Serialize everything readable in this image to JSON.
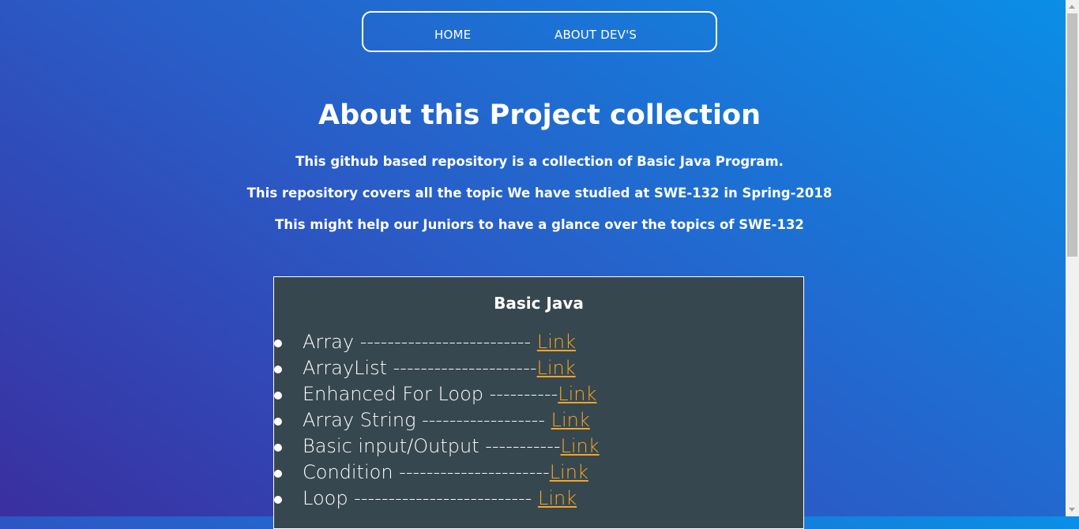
{
  "nav": {
    "home_label": "HOME",
    "about_label": "ABOUT DEV'S"
  },
  "header": {
    "title": "About this Project collection",
    "intro": [
      "This github based repository is a collection of Basic Java Program.",
      "This repository covers all the topic We have studied at SWE-132 in Spring-2018",
      "This might help our Juniors to have a glance over the topics of SWE-132"
    ]
  },
  "section": {
    "title": "Basic Java",
    "items": [
      {
        "name": "Array ------------------------- ",
        "link": "Link"
      },
      {
        "name": "ArrayList ---------------------",
        "link": "Link"
      },
      {
        "name": "Enhanced For Loop ----------",
        "link": "Link"
      },
      {
        "name": "Array String ------------------ ",
        "link": "Link"
      },
      {
        "name": "Basic input/Output -----------",
        "link": "Link"
      },
      {
        "name": "Condition ----------------------",
        "link": "Link"
      },
      {
        "name": "Loop -------------------------- ",
        "link": "Link"
      }
    ]
  },
  "colors": {
    "link": "#f5a623",
    "panel": "#37474f",
    "gradient_start": "#3a2fa0",
    "gradient_end": "#0a8fe6"
  }
}
